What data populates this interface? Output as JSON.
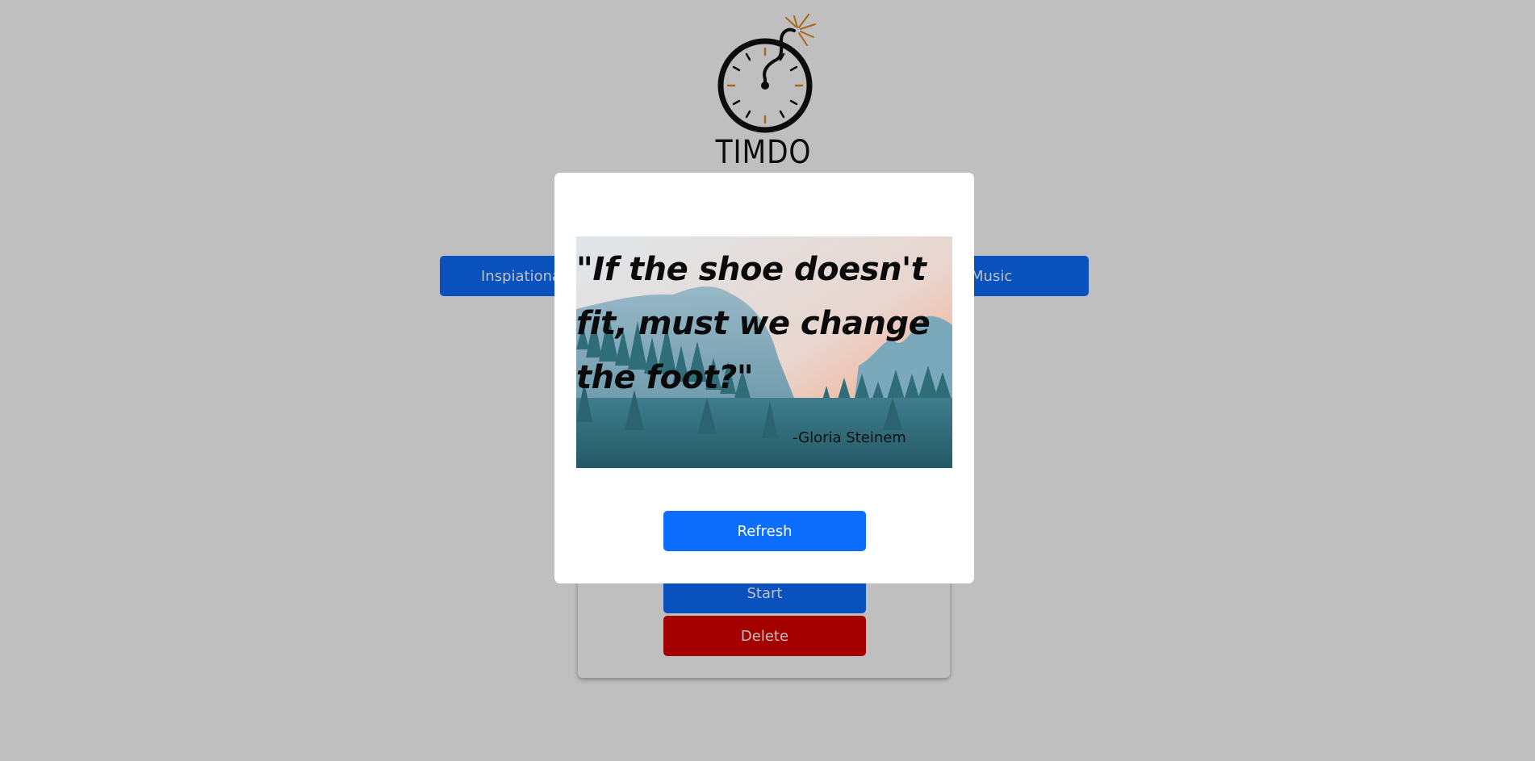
{
  "app": {
    "logo_text": "TIMDO"
  },
  "categories": {
    "inspirational_label": "Inspiational",
    "music_label": "Music"
  },
  "timer_card": {
    "start_label": "Start",
    "delete_label": "Delete"
  },
  "quote_modal": {
    "quote": "\"If the shoe doesn't fit, must we change the foot?\"",
    "author": "-Gloria Steinem",
    "refresh_label": "Refresh"
  },
  "colors": {
    "primary_button": "#0d6efd",
    "danger_button": "#dc0000",
    "logo_accent": "#e08a1e"
  }
}
